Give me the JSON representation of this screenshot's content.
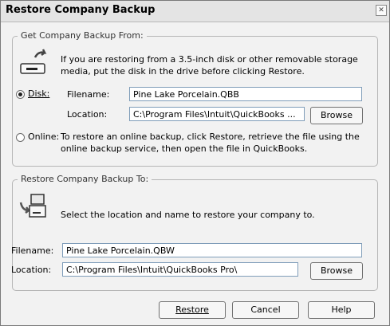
{
  "window": {
    "title": "Restore Company Backup"
  },
  "from": {
    "legend": "Get Company Backup From:",
    "disk_info_line1": "If you are restoring from a 3.5-inch disk or other removable storage",
    "disk_info_line2": "media, put the disk in the drive before clicking Restore.",
    "disk_radio_label": "Disk:",
    "disk_selected": true,
    "filename_label": "Filename:",
    "filename_value": "Pine Lake Porcelain.QBB",
    "location_label": "Location:",
    "location_value": "C:\\Program Files\\Intuit\\QuickBooks ...",
    "browse_label": "Browse",
    "online_radio_label": "Online:",
    "online_info_line1": "To restore an online backup, click Restore, retrieve the file using the",
    "online_info_line2": "online backup service, then open the file in QuickBooks."
  },
  "to": {
    "legend": "Restore Company Backup To:",
    "info": "Select the location and name to restore your company to.",
    "filename_label": "Filename:",
    "filename_value": "Pine Lake Porcelain.QBW",
    "location_label": "Location:",
    "location_value": "C:\\Program Files\\Intuit\\QuickBooks Pro\\",
    "browse_label": "Browse"
  },
  "buttons": {
    "restore": "Restore",
    "cancel": "Cancel",
    "help": "Help"
  }
}
